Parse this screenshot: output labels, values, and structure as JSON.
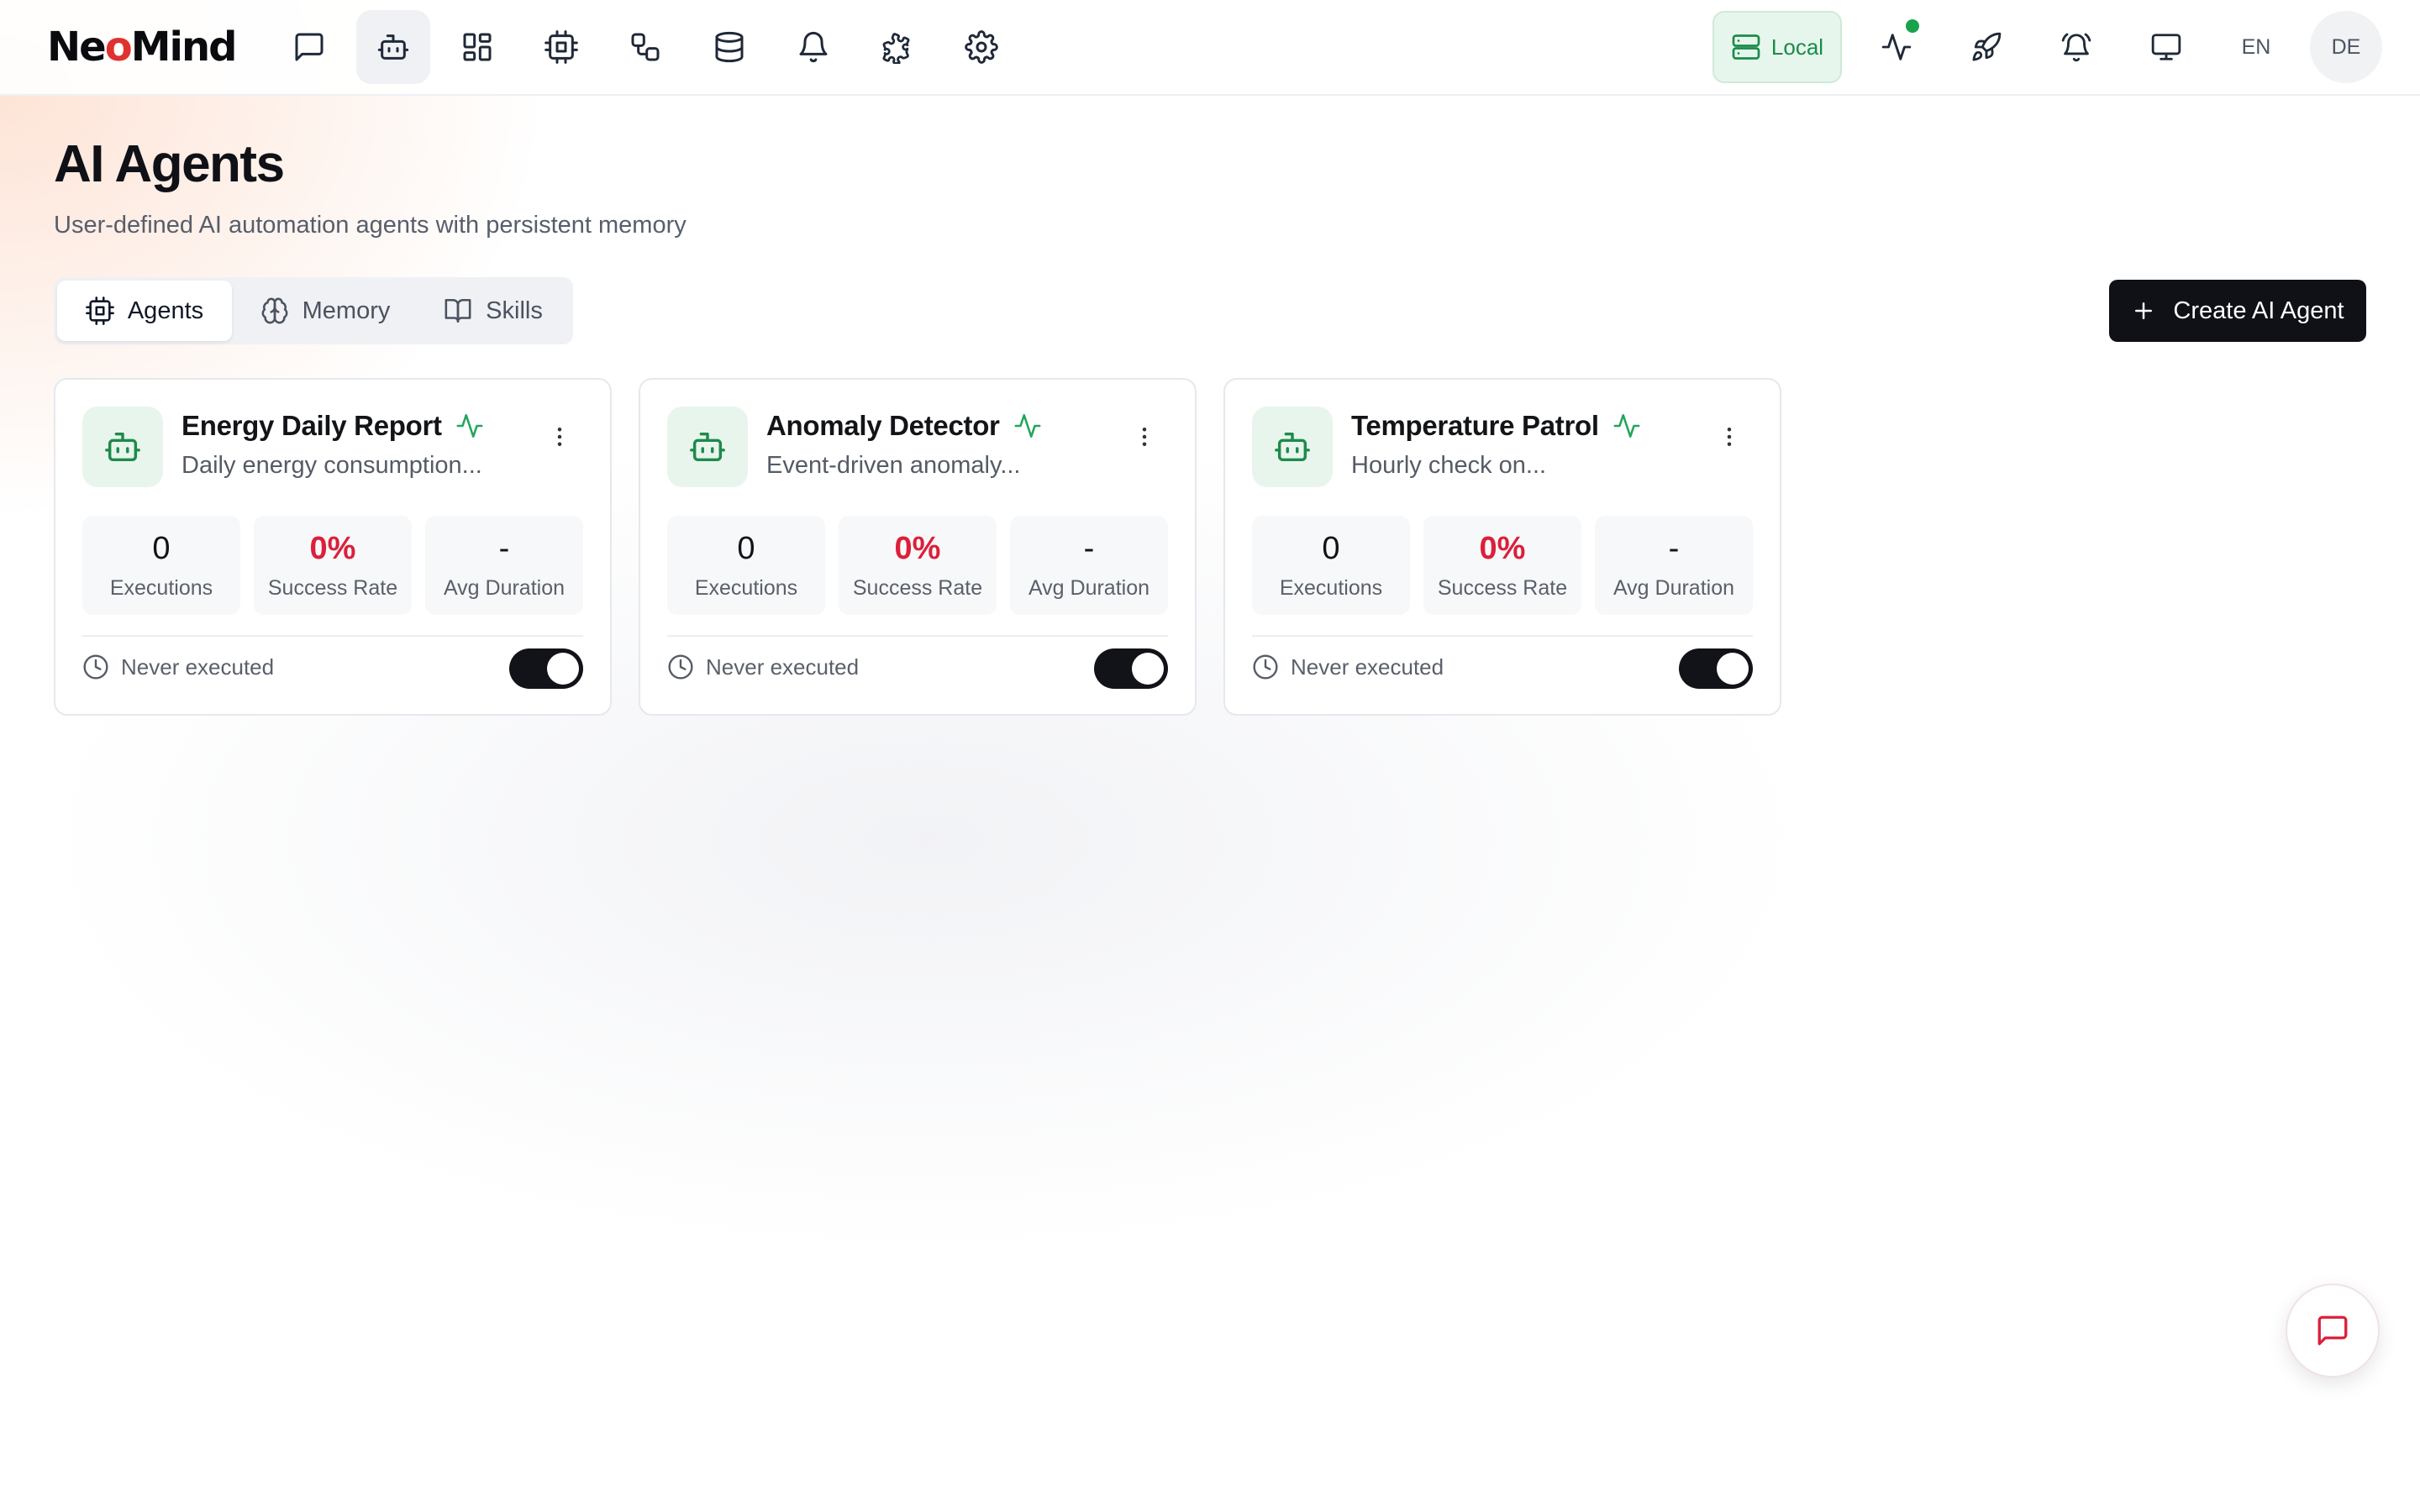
{
  "app": {
    "logo_text_1": "Ne",
    "logo_text_2": "Mind",
    "accent": "#e03131"
  },
  "nav": {
    "items": [
      {
        "name": "chat",
        "icon": "message-square-icon",
        "active": false
      },
      {
        "name": "agents",
        "icon": "bot-icon",
        "active": true
      },
      {
        "name": "dashboard",
        "icon": "layout-grid-icon",
        "active": false
      },
      {
        "name": "devices",
        "icon": "cpu-icon",
        "active": false
      },
      {
        "name": "automation",
        "icon": "workflow-icon",
        "active": false
      },
      {
        "name": "data",
        "icon": "database-icon",
        "active": false
      },
      {
        "name": "alerts",
        "icon": "bell-icon",
        "active": false
      },
      {
        "name": "extensions",
        "icon": "puzzle-icon",
        "active": false
      },
      {
        "name": "settings",
        "icon": "gear-icon",
        "active": false
      }
    ]
  },
  "topbar_right": {
    "local_label": "Local",
    "local_color": "#1a8b4a",
    "lang_en": "EN",
    "lang_de": "DE",
    "icons": [
      "activity-icon",
      "rocket-icon",
      "alarm-bell-icon",
      "monitor-icon"
    ]
  },
  "page": {
    "title": "AI Agents",
    "subtitle": "User-defined AI automation agents with persistent memory"
  },
  "tabs": [
    {
      "label": "Agents",
      "icon": "cpu-icon",
      "active": true
    },
    {
      "label": "Memory",
      "icon": "brain-icon",
      "active": false
    },
    {
      "label": "Skills",
      "icon": "book-open-icon",
      "active": false
    }
  ],
  "actions": {
    "create_label": "Create AI Agent"
  },
  "agents": [
    {
      "name": "Energy Daily Report",
      "description": "Daily energy consumption...",
      "executions": "0",
      "success_rate": "0%",
      "avg_duration": "-",
      "last_run": "Never executed",
      "enabled": true
    },
    {
      "name": "Anomaly Detector",
      "description": "Event-driven anomaly...",
      "executions": "0",
      "success_rate": "0%",
      "avg_duration": "-",
      "last_run": "Never executed",
      "enabled": true
    },
    {
      "name": "Temperature Patrol",
      "description": "Hourly check on...",
      "executions": "0",
      "success_rate": "0%",
      "avg_duration": "-",
      "last_run": "Never executed",
      "enabled": true
    }
  ],
  "stat_labels": {
    "executions": "Executions",
    "success_rate": "Success Rate",
    "avg_duration": "Avg Duration"
  },
  "colors": {
    "primary_dark": "#0f1117",
    "success_green": "#16a34a",
    "danger_red": "#dc1f3a"
  }
}
